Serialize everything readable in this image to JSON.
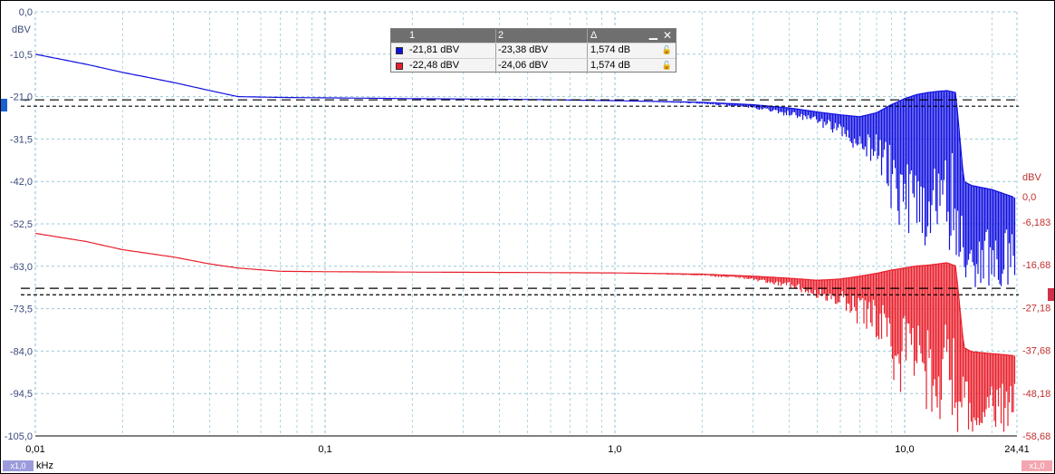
{
  "colors": {
    "ch1": "#1010e0",
    "ch2": "#e8202c",
    "grid": "#9cc9da",
    "left_axis_text": "#3a4a7c",
    "right_axis_text": "#c03030"
  },
  "left_axis": {
    "unit": "dBV",
    "ticks": [
      "0,0",
      "-10,5",
      "-21,0",
      "-31,5",
      "-42,0",
      "-52,5",
      "-63,0",
      "-73,5",
      "-84,0",
      "-94,5",
      "-105,0"
    ],
    "range": [
      -105,
      0
    ]
  },
  "right_axis": {
    "unit": "dBV",
    "ticks": [
      "0,0",
      "-6,183",
      "-16,68",
      "-27,18",
      "-37,68",
      "-48,18",
      "-58,68"
    ],
    "range": [
      -58.68,
      0
    ]
  },
  "x_axis": {
    "unit": "kHz",
    "scale": "log",
    "range": [
      0.01,
      24.41
    ],
    "ticks": [
      "0,01",
      "0,1",
      "1,0",
      "10,0",
      "24,41"
    ]
  },
  "badges": {
    "left": "x1,0",
    "right": "x1,0"
  },
  "cursor_table": {
    "headers": [
      "1",
      "2",
      "Δ"
    ],
    "rows": [
      {
        "channel": "ch1",
        "c1": "-21,81 dBV",
        "c2": "-23,38 dBV",
        "delta": "1,574 dB"
      },
      {
        "channel": "ch2",
        "c1": "-22,48 dBV",
        "c2": "-24,06 dBV",
        "delta": "1,574 dB"
      }
    ],
    "minimize_icon": "minimize-icon",
    "close_icon": "close-icon",
    "lock_icon": "lock-icon"
  },
  "chart_data": {
    "type": "line",
    "x_scale": "log",
    "xlim": [
      0.01,
      24.41
    ],
    "series": [
      {
        "channel": "ch1",
        "axis": "left",
        "ylim": [
          -105,
          0
        ],
        "x": [
          0.01,
          0.015,
          0.02,
          0.03,
          0.04,
          0.05,
          0.07,
          0.1,
          0.2,
          0.5,
          1.0,
          2.0,
          3.0,
          4.0,
          5.0,
          6.0,
          7.0,
          8.0,
          9.0,
          10.0,
          11.0,
          12.0,
          13.0,
          14.0,
          15.0,
          16.0,
          17.0,
          20.0,
          24.0
        ],
        "y": [
          -10.5,
          -13.0,
          -15.0,
          -17.5,
          -19.5,
          -21.0,
          -21.2,
          -21.3,
          -21.5,
          -21.7,
          -22.0,
          -22.4,
          -23.0,
          -23.8,
          -24.8,
          -25.5,
          -26.0,
          -25.0,
          -23.0,
          -21.5,
          -20.5,
          -20.0,
          -19.7,
          -19.5,
          -20.0,
          -42.0,
          -43.0,
          -44.0,
          -46.0
        ],
        "lower_y": [
          -10.5,
          -13.0,
          -15.0,
          -17.5,
          -19.5,
          -21.0,
          -21.2,
          -21.3,
          -21.5,
          -21.7,
          -22.0,
          -22.8,
          -24.0,
          -26.0,
          -28.0,
          -31.0,
          -35.0,
          -38.0,
          -50.0,
          -55.0,
          -60.0,
          -62.0,
          -58.0,
          -63.0,
          -60.0,
          -70.0,
          -68.0,
          -69.0,
          -67.0
        ]
      },
      {
        "channel": "ch2",
        "axis": "right",
        "ylim": [
          -58.68,
          0
        ],
        "x": [
          0.01,
          0.015,
          0.02,
          0.03,
          0.04,
          0.05,
          0.07,
          0.1,
          0.2,
          0.5,
          1.0,
          2.0,
          3.0,
          4.0,
          5.0,
          6.0,
          7.0,
          8.0,
          9.0,
          10.0,
          11.0,
          12.0,
          13.0,
          14.0,
          15.0,
          16.0,
          17.0,
          20.0,
          24.0
        ],
        "y": [
          -9.0,
          -11.0,
          -13.0,
          -14.8,
          -16.5,
          -17.5,
          -18.3,
          -18.4,
          -18.5,
          -18.6,
          -18.7,
          -19.0,
          -19.5,
          -20.0,
          -20.5,
          -20.2,
          -19.5,
          -18.8,
          -18.0,
          -17.5,
          -17.0,
          -16.8,
          -16.5,
          -16.2,
          -17.0,
          -37.0,
          -38.0,
          -38.5,
          -39.0
        ],
        "lower_y": [
          -9.0,
          -11.0,
          -13.0,
          -14.8,
          -16.5,
          -17.5,
          -18.3,
          -18.4,
          -18.5,
          -18.6,
          -18.7,
          -19.4,
          -20.5,
          -22.5,
          -25.0,
          -28.0,
          -32.0,
          -35.0,
          -45.0,
          -50.0,
          -55.0,
          -58.68,
          -55.0,
          -58.68,
          -58.68,
          -58.68,
          -58.68,
          -58.68,
          -58.68
        ]
      }
    ],
    "cursors": {
      "ch1": [
        -21.81,
        -23.38
      ],
      "ch2": [
        -22.48,
        -24.06
      ]
    }
  }
}
